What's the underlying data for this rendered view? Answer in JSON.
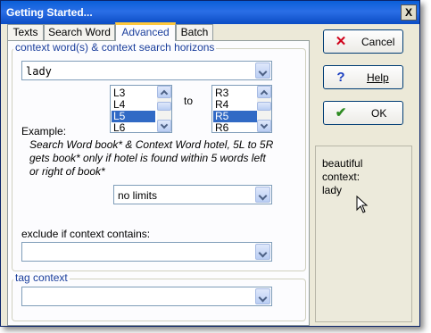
{
  "window": {
    "title": "Getting Started...",
    "close_glyph": "X"
  },
  "tabs": [
    {
      "label": "Texts"
    },
    {
      "label": "Search Word"
    },
    {
      "label": "Advanced"
    },
    {
      "label": "Batch"
    }
  ],
  "context_group": {
    "legend": "context word(s) & context search horizons",
    "word_value": "lady",
    "left_list": [
      "L3",
      "L4",
      "L5",
      "L6"
    ],
    "left_selected": "L5",
    "to_label": "to",
    "right_list": [
      "R3",
      "R4",
      "R5",
      "R6"
    ],
    "right_selected": "R5",
    "example_label": "Example:",
    "example_text": "Search Word book* & Context Word hotel, 5L to 5R gets book* only if hotel is found within 5 words left or right of book*",
    "limit_value": "no limits",
    "exclude_label": "exclude if context contains:",
    "exclude_value": ""
  },
  "tag_group": {
    "legend": "tag context",
    "value": ""
  },
  "buttons": {
    "cancel": {
      "label": "Cancel",
      "icon": "red-x-icon",
      "color": "#d0021b"
    },
    "help": {
      "label": "Help",
      "icon": "question-icon",
      "color": "#1a3ec0"
    },
    "ok": {
      "label": "OK",
      "icon": "green-check-icon",
      "color": "#2e8b22"
    }
  },
  "info_panel": {
    "lines": [
      "beautiful",
      "context:",
      "lady"
    ]
  },
  "colors": {
    "title_bar": "#0a5fd8",
    "selection": "#316ac5",
    "group_text": "#1a3e9c"
  }
}
